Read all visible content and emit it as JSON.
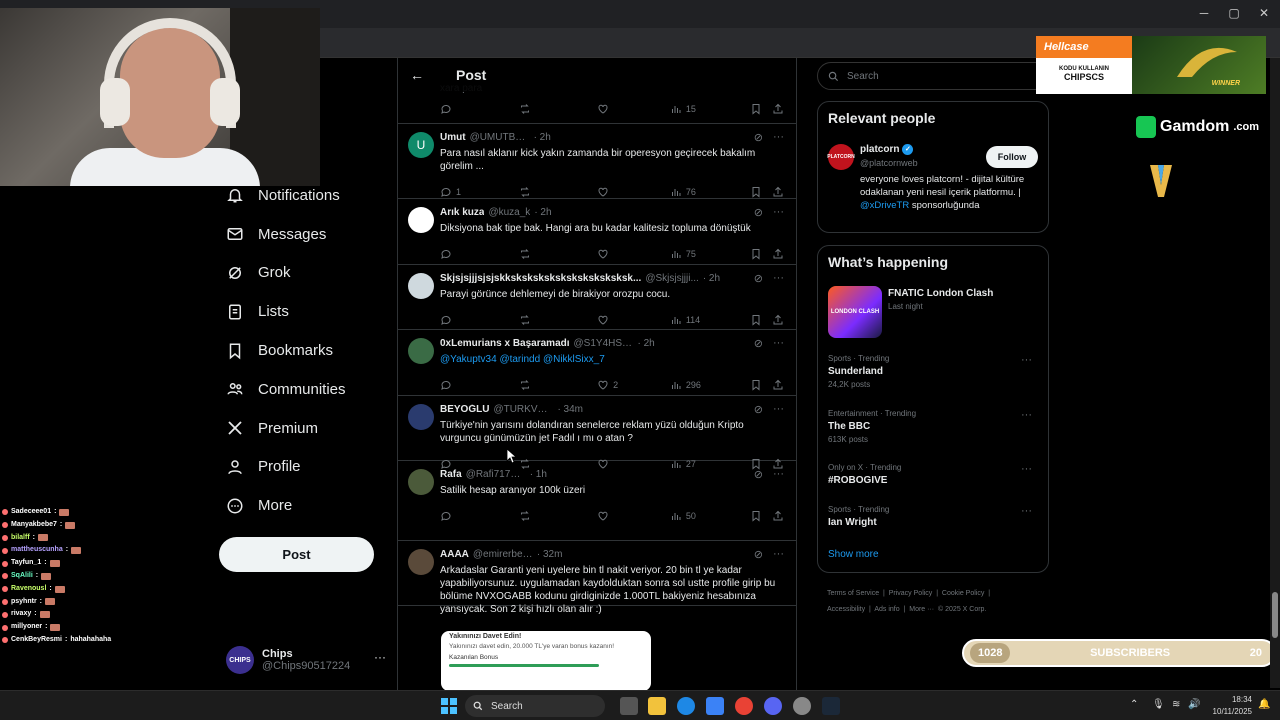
{
  "window": {
    "minimize": "─",
    "maximize": "▢",
    "close": "✕"
  },
  "nav": {
    "items": [
      {
        "label": "Notifications",
        "icon": "bell-icon"
      },
      {
        "label": "Messages",
        "icon": "mail-icon"
      },
      {
        "label": "Grok",
        "icon": "grok-icon"
      },
      {
        "label": "Lists",
        "icon": "list-icon"
      },
      {
        "label": "Bookmarks",
        "icon": "bookmark-icon"
      },
      {
        "label": "Communities",
        "icon": "people-icon"
      },
      {
        "label": "Premium",
        "icon": "x-icon"
      },
      {
        "label": "Profile",
        "icon": "person-icon"
      },
      {
        "label": "More",
        "icon": "more-circle-icon"
      }
    ],
    "post_button": "Post"
  },
  "account": {
    "avatar_text": "CHIPS",
    "name": "Chips",
    "handle": "@Chips90517224",
    "more": "···"
  },
  "header": {
    "back": "←",
    "title": "Post"
  },
  "replies": [
    {
      "avatar": "U",
      "avatar_color": "#0f8a6a",
      "name": "Umut",
      "handle": "@UMUTBLK4",
      "time": "· 2h",
      "text": "Para nasıl aklanır kick yakın zamanda bir operesyon geçirecek bakalım görelim ...",
      "replies": "1",
      "retweets": "",
      "likes": "",
      "views": "76"
    },
    {
      "avatar": "",
      "avatar_color": "#ffffff",
      "name": "Arık kuza",
      "handle": "@kuza_k",
      "time": "· 2h",
      "text": "Diksiyona bak tipe bak. Hangi ara bu kadar kalitesiz topluma dönüştük",
      "replies": "",
      "retweets": "",
      "likes": "",
      "views": "75"
    },
    {
      "avatar": "",
      "avatar_color": "#cfd9de",
      "name": "Skjsjsjjjsjsjskksksksksksksksksksksksk...",
      "handle": "@Skjsjsjjji...",
      "time": "· 2h",
      "text": "Parayi görünce dehlemeyi de birakiyor orozpu cocu.",
      "replies": "",
      "retweets": "",
      "likes": "",
      "views": "114"
    },
    {
      "avatar": "",
      "avatar_color": "#3a6b45",
      "name": "0xLemurians x Başaramadı",
      "handle": "@S1Y4HS4NC4KS",
      "time": "· 2h",
      "text": "@Yakuptv34 @tarindd @NikklSixx_7",
      "replies": "",
      "retweets": "",
      "likes": "2",
      "views": "296"
    },
    {
      "avatar": "",
      "avatar_color": "#2a3b6e",
      "name": "BEYOĞLU",
      "handle": "@TURKVEKILI",
      "time": "· 34m",
      "text": "Türkiye'nin yarısını dolandıran senelerce reklam yüzü olduğun Kripto vurguncu günümüzün jet Fadıl ı mı o atan ?",
      "replies": "",
      "retweets": "",
      "likes": "",
      "views": "27"
    },
    {
      "avatar": "",
      "avatar_color": "#4b5a3a",
      "name": "Rafa",
      "handle": "@Rafi71749885",
      "time": "· 1h",
      "text": "Satilik hesap aranıyor 100k üzeri",
      "replies": "",
      "retweets": "",
      "likes": "",
      "views": "50"
    },
    {
      "avatar": "",
      "avatar_color": "#5a4a3a",
      "name": "AAAA",
      "handle": "@emirerbeden0",
      "time": "· 32m",
      "text": "Arkadaslar Garanti yeni uyelere bin tl nakit veriyor. 20 bin tl ye kadar yapabiliyorsunuz. uygulamadan kaydolduktan sonra sol ustte profile girip bu bölüme NVXOGABB kodunu girdiginizde 1.000TL bakiyeniz hesabınıza yansıycak. Son 2 kişi hızlı olan alır :)",
      "replies": "",
      "retweets": "",
      "likes": "",
      "views": ""
    }
  ],
  "top_partial": {
    "text": "xara para",
    "views": "15"
  },
  "embed_card": {
    "title": "Yakınınızı Davet Edin!",
    "body": "Yakınınızı davet edin, 20.000 TL'ye varan bonus kazanın!",
    "label": "Kazanılan Bonus"
  },
  "search": {
    "placeholder": "Search"
  },
  "relevant": {
    "title": "Relevant people",
    "avatar_text": "PLATCORN",
    "name": "platcorn",
    "handle": "@platcornweb",
    "follow": "Follow",
    "bio": "everyone loves platcorn! - dijital kültüre odaklanan yeni nesil içerik platformu. |",
    "bio_link": "@xDriveTR",
    "bio_end": "sponsorluğunda"
  },
  "happening": {
    "title": "What’s happening",
    "event": {
      "name": "FNATIC London Clash",
      "time": "Last night",
      "image_text": "LONDON CLASH"
    },
    "trends": [
      {
        "meta": "Sports · Trending",
        "name": "Sunderland",
        "count": "24,2K posts"
      },
      {
        "meta": "Entertainment · Trending",
        "name": "The BBC",
        "count": "613K posts"
      },
      {
        "meta": "Only on X · Trending",
        "name": "#ROBOGIVE",
        "count": ""
      },
      {
        "meta": "Sports · Trending",
        "name": "Ian Wright",
        "count": ""
      }
    ],
    "show_more": "Show more"
  },
  "footer": {
    "links": [
      "Terms of Service",
      "Privacy Policy",
      "Cookie Policy",
      "Accessibility",
      "Ads info",
      "More ···",
      "© 2025 X Corp."
    ]
  },
  "chat": [
    {
      "user": "Sadeceee01",
      "msg": "",
      "color": "#ffffff"
    },
    {
      "user": "Manyakbebe7",
      "msg": "",
      "color": "#ffffff"
    },
    {
      "user": "bilalff",
      "msg": "",
      "color": "#c8ff6a"
    },
    {
      "user": "mattheuscunha",
      "msg": "",
      "color": "#b6a2ff"
    },
    {
      "user": "Tayfun_1",
      "msg": "",
      "color": "#ffffff"
    },
    {
      "user": "SqAlili",
      "msg": "",
      "color": "#6affc5"
    },
    {
      "user": "Ravenousl",
      "msg": "",
      "color": "#c8ff6a"
    },
    {
      "user": "psyhntr",
      "msg": "",
      "color": "#ffffff"
    },
    {
      "user": "rivaxy",
      "msg": "",
      "color": "#ffffff"
    },
    {
      "user": "millyoner",
      "msg": "",
      "color": "#ffffff"
    },
    {
      "user": "CenkBeyResmi",
      "msg": "hahahahaha",
      "color": "#ffffff"
    }
  ],
  "overlays": {
    "hellcase_brand": "Hellcase",
    "hellcase_line1": "KODU KULLANIN",
    "hellcase_line2": "CHIPSCS",
    "hellcase_winner": "WINNER",
    "gamdom": "Gamdom",
    "gamdom_suffix": ".com",
    "subs_left": "1028",
    "subs_label": "SUBSCRIBERS",
    "subs_right": "20"
  },
  "taskbar": {
    "search": "Search",
    "time": "18:34",
    "date": "10/11/2025"
  }
}
